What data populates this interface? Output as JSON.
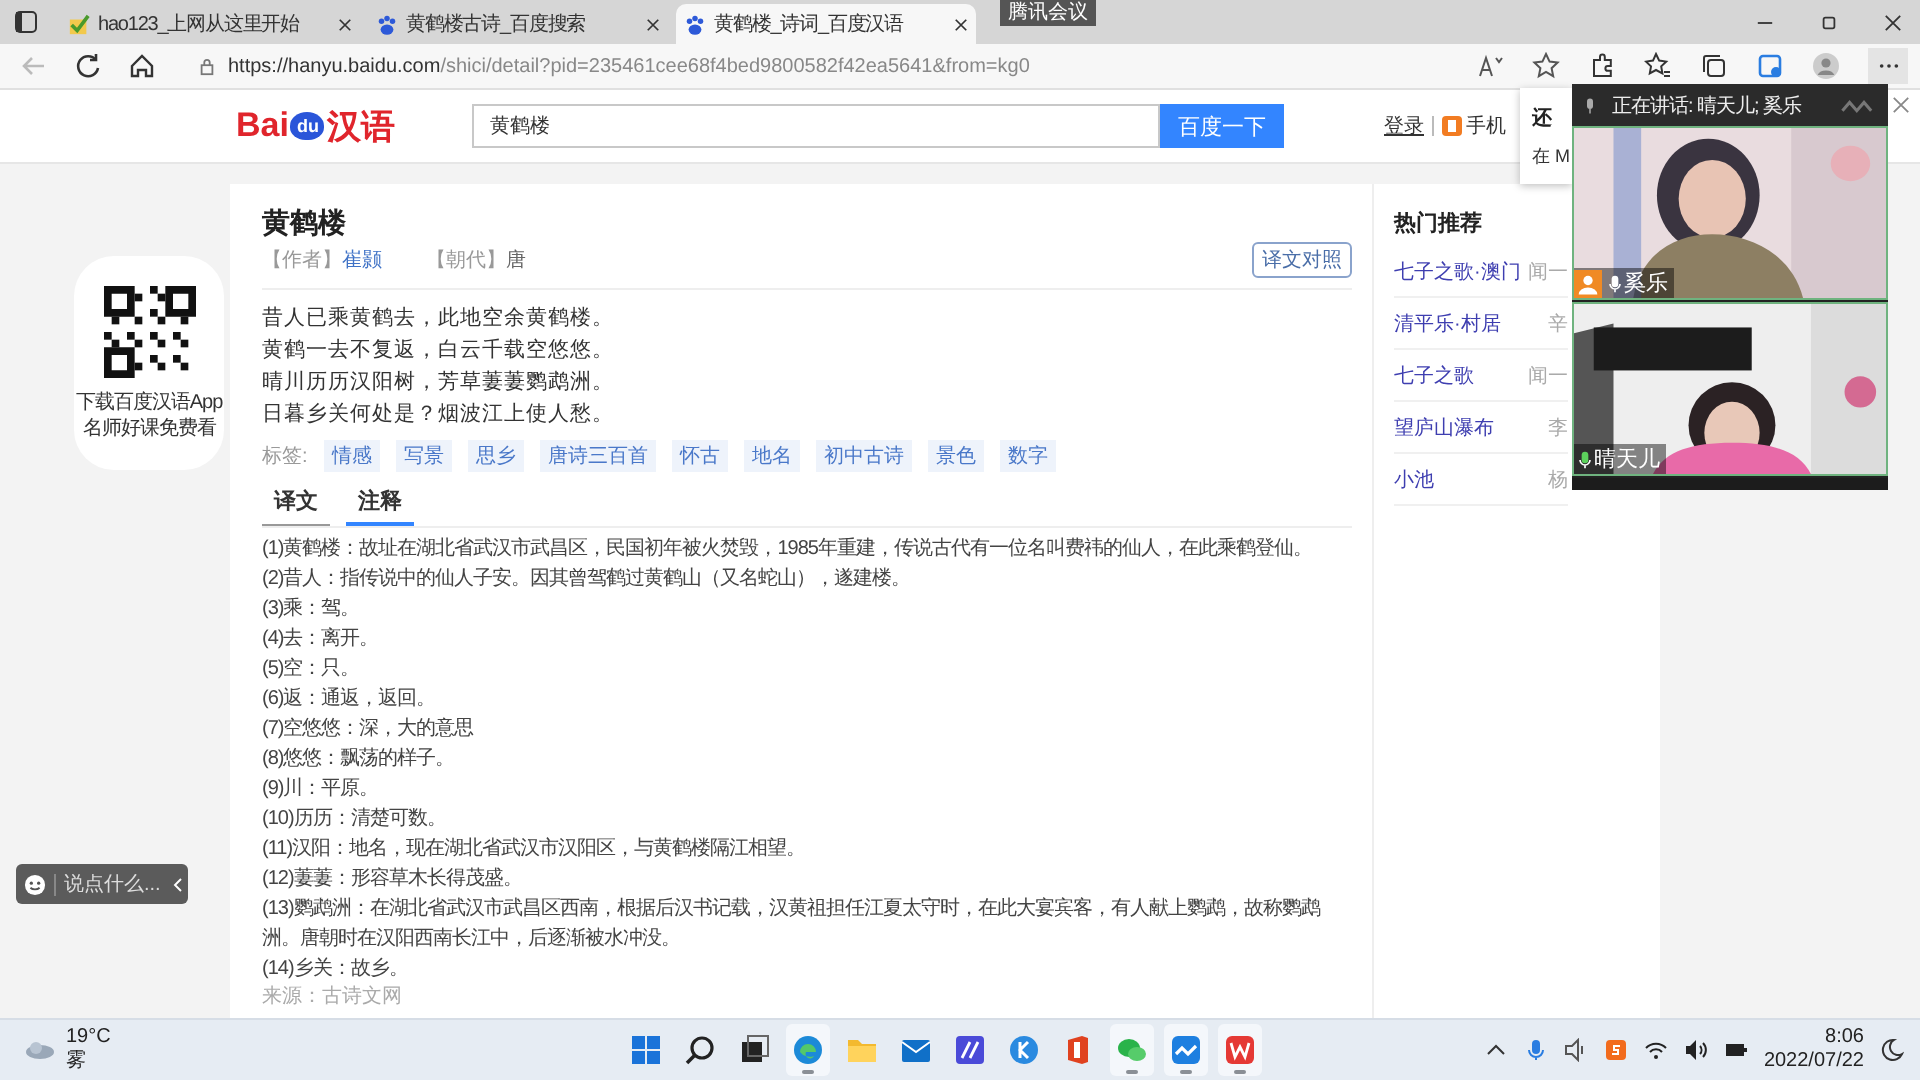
{
  "browser": {
    "tabs": [
      {
        "title": "hao123_上网从这里开始",
        "kind": "check",
        "selected": false
      },
      {
        "title": "黄鹤楼古诗_百度搜索",
        "kind": "paw",
        "selected": false
      },
      {
        "title": "黄鹤楼_诗词_百度汉语",
        "kind": "paw",
        "selected": true
      }
    ],
    "tooltip": "腾讯会议",
    "url_host": "https://hanyu.baidu.com",
    "url_path": "/shici/detail?pid=235461cee68f4bed9800582f42ea5641&from=kg0"
  },
  "site_header": {
    "logo_left": "Bai",
    "logo_paw": "du",
    "logo_right": "汉语",
    "search_value": "黄鹤楼",
    "search_button": "百度一下",
    "login": "登录",
    "mobile": "手机"
  },
  "qr_promo": {
    "lines": [
      "下载百度汉语App",
      "名师好课免费看"
    ]
  },
  "poem": {
    "title": "黄鹤楼",
    "author_label": "【作者】",
    "author": "崔颢",
    "dynasty_label": "【朝代】",
    "dynasty": "唐",
    "compare_button": "译文对照",
    "lines": [
      "昔人已乘黄鹤去，此地空余黄鹤楼。",
      "黄鹤一去不复返，白云千载空悠悠。",
      "晴川历历汉阳树，芳草萋萋鹦鹉洲。",
      "日暮乡关何处是？烟波江上使人愁。"
    ],
    "tags_label": "标签:",
    "tags": [
      "情感",
      "写景",
      "思乡",
      "唐诗三百首",
      "怀古",
      "地名",
      "初中古诗",
      "景色",
      "数字"
    ],
    "tabs": [
      {
        "label": "译文",
        "selected": false
      },
      {
        "label": "注释",
        "selected": true
      }
    ],
    "notes": [
      "(1)黄鹤楼：故址在湖北省武汉市武昌区，民国初年被火焚毁，1985年重建，传说古代有一位名叫费祎的仙人，在此乘鹤登仙。",
      "(2)昔人：指传说中的仙人子安。因其曾驾鹤过黄鹤山（又名蛇山），遂建楼。",
      "(3)乘：驾。",
      "(4)去：离开。",
      "(5)空：只。",
      "(6)返：通返，返回。",
      "(7)空悠悠：深，大的意思",
      "(8)悠悠：飘荡的样子。",
      "(9)川：平原。",
      "(10)历历：清楚可数。",
      "(11)汉阳：地名，现在湖北省武汉市汉阳区，与黄鹤楼隔江相望。",
      "(12)萋萋：形容草木长得茂盛。",
      "(13)鹦鹉洲：在湖北省武汉市武昌区西南，根据后汉书记载，汉黄祖担任江夏太守时，在此大宴宾客，有人献上鹦鹉，故称鹦鹉洲。唐朝时在汉阳西南长江中，后逐渐被水冲没。",
      "(14)乡关：故乡。"
    ],
    "source": "来源：古诗文网"
  },
  "hot": {
    "title": "热门推荐",
    "items": [
      {
        "title": "七子之歌·澳门",
        "author": "闻一"
      },
      {
        "title": "清平乐·村居",
        "author": "辛"
      },
      {
        "title": "七子之歌",
        "author": "闻一"
      },
      {
        "title": "望庐山瀑布",
        "author": "李"
      },
      {
        "title": "小池",
        "author": "杨"
      }
    ]
  },
  "chat_widget": {
    "placeholder": "说点什么..."
  },
  "popup": {
    "title": "还",
    "text": "在 M"
  },
  "meeting": {
    "speaking": "正在讲话: 晴天儿; 奚乐",
    "participants": [
      {
        "name": "奚乐",
        "host": true
      },
      {
        "name": "晴天儿",
        "host": false
      }
    ]
  },
  "taskbar": {
    "temperature": "19°C",
    "weather": "雾",
    "apps": [
      {
        "kind": "start",
        "running": false
      },
      {
        "kind": "search",
        "running": false
      },
      {
        "kind": "taskview",
        "running": false
      },
      {
        "kind": "browser",
        "running": true
      },
      {
        "kind": "folder",
        "running": false
      },
      {
        "kind": "mail",
        "running": false
      },
      {
        "kind": "editor",
        "running": false
      },
      {
        "kind": "k",
        "running": false
      },
      {
        "kind": "office",
        "running": false
      },
      {
        "kind": "chat",
        "running": true
      },
      {
        "kind": "meeting",
        "running": true
      },
      {
        "kind": "wps",
        "running": true
      }
    ],
    "time": "8:06",
    "date": "2022/07/22"
  }
}
